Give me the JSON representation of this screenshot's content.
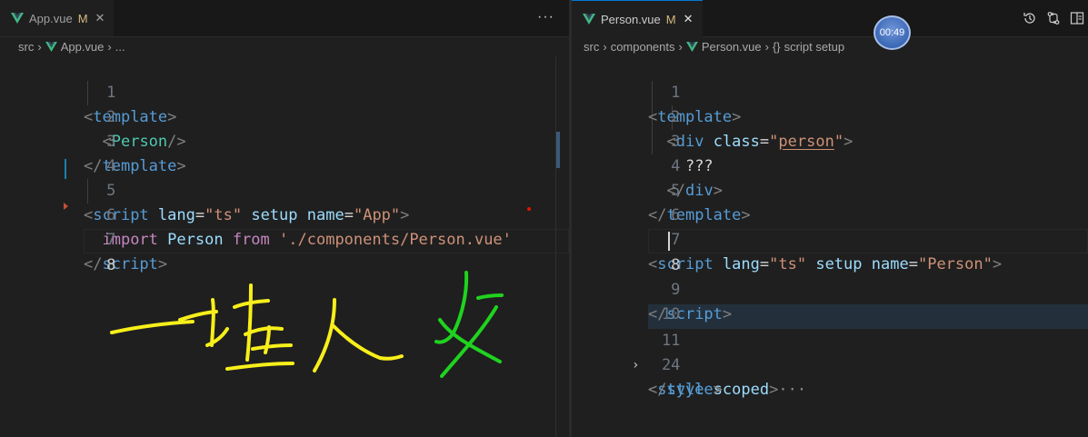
{
  "left": {
    "tab": {
      "label": "App.vue",
      "badge": "M",
      "close": "✕",
      "icon": "vue-icon"
    },
    "more": "···",
    "breadcrumb": {
      "src": "src",
      "file": "App.vue",
      "tail": "..."
    },
    "lines": {
      "n1": "1",
      "n2": "2",
      "n3": "3",
      "n4": "4",
      "n5": "5",
      "n6": "6",
      "n7": "7",
      "n8": "8",
      "l1_tag": "template",
      "l2_tag": "Person",
      "l3_tag": "template",
      "l5_tag": "script",
      "l5_attr1": "lang",
      "l5_val1": "\"ts\"",
      "l5_attr2": "setup",
      "l5_attr3": "name",
      "l5_val3": "\"App\"",
      "l6_import": "import",
      "l6_id": "Person",
      "l6_from": "from",
      "l6_path": "'./components/Person.vue'",
      "l7_tag": "script"
    }
  },
  "right": {
    "tab": {
      "label": "Person.vue",
      "badge": "M",
      "close": "✕",
      "icon": "vue-icon"
    },
    "toolbar": [
      "history-icon",
      "compare-changes-icon",
      "split-editor-icon"
    ],
    "breadcrumb": {
      "src": "src",
      "folder": "components",
      "file": "Person.vue",
      "symbol_icon": "{}",
      "symbol": "script setup"
    },
    "timer": "00:49",
    "lines": {
      "n1": "1",
      "n2": "2",
      "n3": "3",
      "n4": "4",
      "n5": "5",
      "n6": "6",
      "n7": "7",
      "n8": "8",
      "n9": "9",
      "n10": "10",
      "n11": "11",
      "n24": "24",
      "l1_tag": "template",
      "l2_tag": "div",
      "l2_attr": "class",
      "l2_val": "person",
      "l3_text": "???",
      "l4_tag": "div",
      "l5_tag": "template",
      "l7_tag": "script",
      "l7_attr1": "lang",
      "l7_val1": "\"ts\"",
      "l7_attr2": "setup",
      "l7_attr3": "name",
      "l7_val3": "\"Person\"",
      "l9_tag": "script",
      "l11_tag": "style",
      "l11_attr": "scoped",
      "l11_ellipsis": "···",
      "l24_tag": "style"
    }
  },
  "colors": {
    "accent": "#0078d4",
    "vue_green": "#41b883",
    "ink_yellow": "#f7ef1a",
    "ink_green": "#1fd31f"
  }
}
